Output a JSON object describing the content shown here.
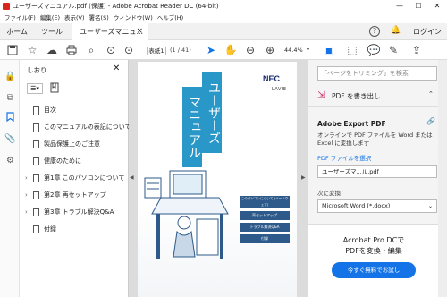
{
  "window": {
    "title": "ユーザーズマニュアル.pdf (保護) - Adobe Acrobat Reader DC (64-bit)",
    "min": "—",
    "max": "☐",
    "close": "✕"
  },
  "menu": [
    "ファイル(F)",
    "編集(E)",
    "表示(V)",
    "署名(S)",
    "ウィンドウ(W)",
    "ヘルプ(H)"
  ],
  "tabs": {
    "home": "ホーム",
    "tools": "ツール",
    "doc": "ユーザーズマニュ...",
    "close": "×"
  },
  "tabbar_right": {
    "login": "ログイン"
  },
  "toolbar": {
    "page_current": "表紙1",
    "page_total": "(1 / 41)",
    "zoom": "44.4%"
  },
  "bookmarks": {
    "title": "しおり",
    "items": [
      {
        "label": "目次",
        "expandable": false
      },
      {
        "label": "このマニュアルの表記について",
        "expandable": false
      },
      {
        "label": "製品保護上のご注意",
        "expandable": false
      },
      {
        "label": "健康のために",
        "expandable": false
      },
      {
        "label": "第1章 このパソコンについて",
        "expandable": true
      },
      {
        "label": "第2章 再セットアップ",
        "expandable": true
      },
      {
        "label": "第3章 トラブル解決Q&A",
        "expandable": true
      },
      {
        "label": "付録",
        "expandable": false
      }
    ]
  },
  "cover": {
    "title_line1": "ユーザーズ",
    "title_line2": "マニュアル",
    "brand": "NEC",
    "sub_brand": "LAVIE",
    "menu_items": [
      "このパソコンについて (ハードウェア)",
      "再セットアップ",
      "トラブル解決Q&A",
      "付録"
    ]
  },
  "right_panel": {
    "search_placeholder": "「ページをトリミング」を検索",
    "export_header": "PDF を書き出し",
    "export_title": "Adobe Export PDF",
    "export_desc": "オンラインで PDF ファイルを Word または Excel に変換します",
    "pdf_file_label": "PDF ファイルを選択",
    "pdf_file_value": "ユーザーズマ...ル.pdf",
    "convert_label": "次に変換：",
    "convert_value": "Microsoft Word (*.docx)",
    "promo_line1": "Acrobat Pro DCで",
    "promo_line2": "PDFを変換・編集",
    "promo_button": "今すぐ無料でお試し"
  },
  "colors": {
    "accent": "#1473e6",
    "cover_blue": "#2a97c9",
    "cover_dark": "#2d5a8a"
  }
}
